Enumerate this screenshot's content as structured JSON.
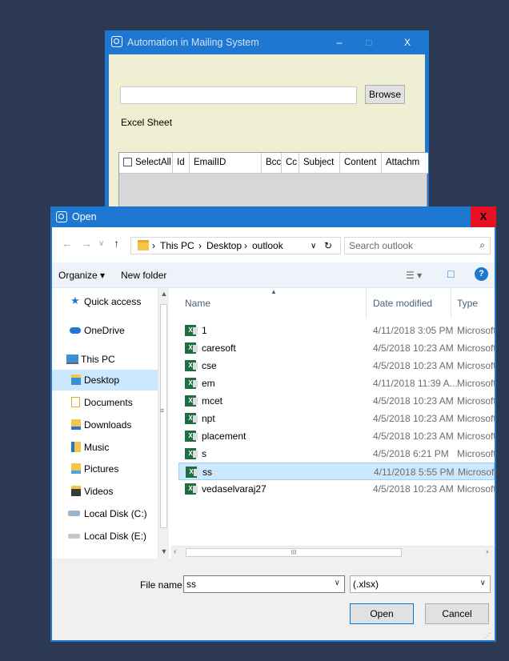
{
  "app": {
    "title": "Automation in Mailing System",
    "minimize": "–",
    "maximize": "□",
    "close": "X",
    "file_input_value": "",
    "browse_label": "Browse",
    "excel_label": "Excel Sheet",
    "grid_columns": [
      "SelectAll",
      "Id",
      "EmailID",
      "Bcc",
      "Cc",
      "Subject",
      "Content",
      "Attachm"
    ]
  },
  "dialog": {
    "title": "Open",
    "close": "X",
    "nav": {
      "back": "←",
      "forward": "→",
      "dropdown": "∨",
      "up": "↑"
    },
    "address": [
      "This PC",
      "Desktop",
      "outlook"
    ],
    "address_sep": "›",
    "address_dropdown": "∨",
    "refresh": "↻",
    "search_placeholder": "Search outlook",
    "search_icon": "⌕",
    "toolbar": {
      "organize": "Organize ▾",
      "new_folder": "New folder",
      "view": "☰ ▾",
      "preview": "□",
      "help": "?"
    },
    "sidebar": [
      {
        "label": "Quick access",
        "icon": "star-icon"
      },
      {
        "label": "OneDrive",
        "icon": "cloud-icon"
      },
      {
        "label": "This PC",
        "icon": "computer-icon"
      },
      {
        "label": "Desktop",
        "icon": "desktop-folder-icon",
        "selected": true
      },
      {
        "label": "Documents",
        "icon": "documents-icon"
      },
      {
        "label": "Downloads",
        "icon": "downloads-icon"
      },
      {
        "label": "Music",
        "icon": "music-icon"
      },
      {
        "label": "Pictures",
        "icon": "pictures-icon"
      },
      {
        "label": "Videos",
        "icon": "videos-icon"
      },
      {
        "label": "Local Disk (C:)",
        "icon": "drive-c-icon"
      },
      {
        "label": "Local Disk (E:)",
        "icon": "drive-e-icon"
      }
    ],
    "columns": {
      "name": "Name",
      "date": "Date modified",
      "type": "Type"
    },
    "files": [
      {
        "name": "1",
        "date": "4/11/2018 3:05 PM",
        "type": "Microsoft"
      },
      {
        "name": "caresoft",
        "date": "4/5/2018 10:23 AM",
        "type": "Microsoft"
      },
      {
        "name": "cse",
        "date": "4/5/2018 10:23 AM",
        "type": "Microsoft"
      },
      {
        "name": "em",
        "date": "4/11/2018 11:39 A...",
        "type": "Microsoft"
      },
      {
        "name": "mcet",
        "date": "4/5/2018 10:23 AM",
        "type": "Microsoft"
      },
      {
        "name": "npt",
        "date": "4/5/2018 10:23 AM",
        "type": "Microsoft"
      },
      {
        "name": "placement",
        "date": "4/5/2018 10:23 AM",
        "type": "Microsoft"
      },
      {
        "name": "s",
        "date": "4/5/2018 6:21 PM",
        "type": "Microsoft"
      },
      {
        "name": "ss",
        "date": "4/11/2018 5:55 PM",
        "type": "Microsoft",
        "selected": true
      },
      {
        "name": "vedaselvaraj27",
        "date": "4/5/2018 10:23 AM",
        "type": "Microsoft"
      }
    ],
    "hscroll_thumb": "III",
    "file_name_label": "File name:",
    "file_name_value": "ss",
    "file_type_value": "(.xlsx)",
    "open_label": "Open",
    "cancel_label": "Cancel"
  }
}
